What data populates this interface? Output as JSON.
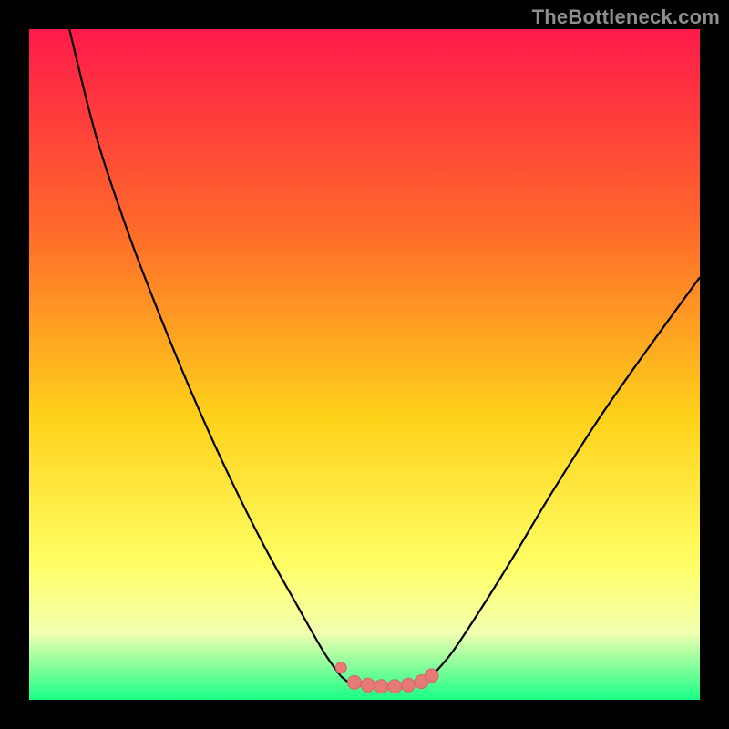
{
  "watermark": "TheBottleneck.com",
  "colors": {
    "background": "#000000",
    "grad_top": "#ff1a4a",
    "grad_upper_mid": "#ff6a2a",
    "grad_mid": "#ffd21a",
    "grad_lower_mid": "#ffff66",
    "grad_band_pale": "#f2ffb0",
    "grad_bottom": "#19ff86",
    "curve": "#000000",
    "marker_fill": "#e77a77",
    "marker_stroke": "#d86460"
  },
  "chart_data": {
    "type": "line",
    "title": "",
    "xlabel": "",
    "ylabel": "",
    "xlim": [
      0,
      100
    ],
    "ylim": [
      0,
      100
    ],
    "series": [
      {
        "name": "left-branch",
        "x": [
          6,
          10,
          15,
          20,
          25,
          30,
          35,
          40,
          44,
          46.5
        ],
        "values": [
          100,
          84,
          69,
          56,
          44,
          33,
          23,
          14,
          7,
          3.5
        ]
      },
      {
        "name": "right-branch",
        "x": [
          60,
          63,
          67,
          72,
          78,
          85,
          92,
          100
        ],
        "values": [
          3.5,
          7,
          13,
          21,
          31,
          42,
          52,
          63
        ]
      },
      {
        "name": "flat-minimum",
        "x": [
          46.5,
          48,
          50,
          52,
          54,
          56,
          58,
          60
        ],
        "values": [
          3.5,
          2.4,
          2.1,
          2.0,
          2.0,
          2.1,
          2.5,
          3.5
        ]
      }
    ],
    "markers": {
      "name": "bottom-dots",
      "x": [
        46.5,
        48.5,
        50.5,
        52.5,
        54.5,
        56.5,
        58.5,
        60
      ],
      "values": [
        3.6,
        2.6,
        2.2,
        2.0,
        2.0,
        2.2,
        2.7,
        3.6
      ],
      "note": "clustered salmon dots along the valley floor; leftmost dot sits slightly above the chain"
    }
  }
}
